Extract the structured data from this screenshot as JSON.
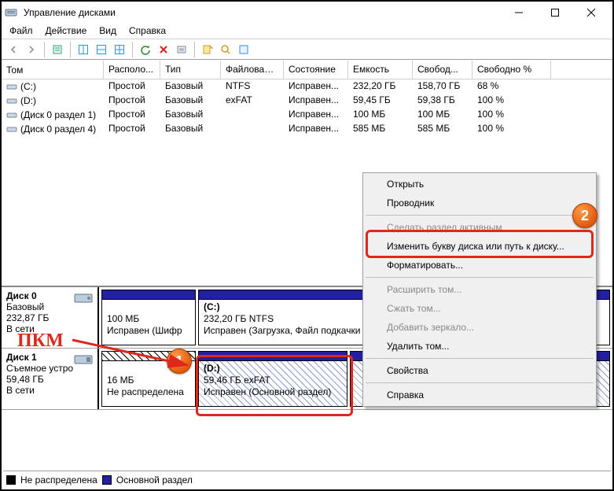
{
  "titlebar": {
    "title": "Управление дисками"
  },
  "menubar": [
    "Файл",
    "Действие",
    "Вид",
    "Справка"
  ],
  "table": {
    "headers": [
      "Том",
      "Располо...",
      "Тип",
      "Файловая с...",
      "Состояние",
      "Емкость",
      "Свобод...",
      "Свободно %"
    ],
    "rows": [
      {
        "vol": "(C:)",
        "loc": "Простой",
        "type": "Базовый",
        "fs": "NTFS",
        "state": "Исправен...",
        "cap": "232,20 ГБ",
        "free": "158,70 ГБ",
        "pct": "68 %"
      },
      {
        "vol": "(D:)",
        "loc": "Простой",
        "type": "Базовый",
        "fs": "exFAT",
        "state": "Исправен...",
        "cap": "59,45 ГБ",
        "free": "59,38 ГБ",
        "pct": "100 %"
      },
      {
        "vol": "(Диск 0 раздел 1)",
        "loc": "Простой",
        "type": "Базовый",
        "fs": "",
        "state": "Исправен...",
        "cap": "100 МБ",
        "free": "100 МБ",
        "pct": "100 %"
      },
      {
        "vol": "(Диск 0 раздел 4)",
        "loc": "Простой",
        "type": "Базовый",
        "fs": "",
        "state": "Исправен...",
        "cap": "585 МБ",
        "free": "585 МБ",
        "pct": "100 %"
      }
    ]
  },
  "disks": {
    "d0": {
      "name": "Диск 0",
      "type": "Базовый",
      "size": "232,87 ГБ",
      "status": "В сети",
      "p0": {
        "size": "100 МБ",
        "state": "Исправен (Шифр"
      },
      "p1": {
        "label": "(C:)",
        "desc": "232,20 ГБ NTFS",
        "state": "Исправен (Загрузка, Файл подкачки"
      }
    },
    "d1": {
      "name": "Диск 1",
      "type": "Съемное устро",
      "size": "59,48 ГБ",
      "status": "В сети",
      "p0": {
        "size": "16 МБ",
        "state": "Не распределена"
      },
      "p1": {
        "label": "(D:)",
        "desc": "59,46 ГБ exFAT",
        "state": "Исправен (Основной раздел)"
      }
    }
  },
  "context_menu": {
    "open": "Открыть",
    "explorer": "Проводник",
    "active": "Сделать раздел активным",
    "change_letter": "Изменить букву диска или путь к диску...",
    "format": "Форматировать...",
    "extend": "Расширить том...",
    "shrink": "Сжать том...",
    "mirror": "Добавить зеркало...",
    "delete": "Удалить том...",
    "props": "Свойства",
    "help": "Справка"
  },
  "legend": {
    "unalloc": "Не распределена",
    "primary": "Основной раздел"
  },
  "annotations": {
    "pkm": "ПКМ",
    "badge1": "1",
    "badge2": "2"
  }
}
